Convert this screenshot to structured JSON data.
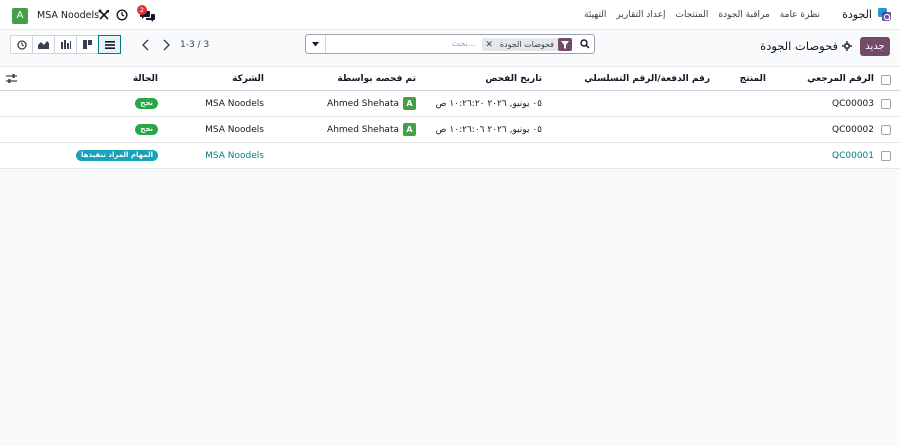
{
  "navbar": {
    "app_title": "الجودة",
    "menu": [
      "نظرة عامة",
      "مراقبة الجودة",
      "المنتجات",
      "إعداد التقارير",
      "التهيئة"
    ],
    "company_avatar_letter": "A",
    "company_name": "MSA Noodels",
    "chat_badge": "2"
  },
  "control": {
    "new_button": "جديد",
    "breadcrumb": "فحوصات الجودة",
    "search": {
      "facet_label": "فحوصات الجودة",
      "facet_remove": "✕",
      "placeholder": "بحث..."
    },
    "pager": "1-3 / 3"
  },
  "table": {
    "columns": {
      "reference": "الرقم المرجعي",
      "product": "المنتج",
      "lot": "رقم الدفعة/الرقم التسلسلي",
      "date": "تاريخ الفحص",
      "checked_by": "تم فحصه بواسطة",
      "company": "الشركة",
      "state": "الحالة"
    },
    "rows": [
      {
        "reference": "QC00003",
        "date": "٠٥ يونيو, ٢٠٢٦ ١٠:٢٦:٢٠ ص",
        "checked_by_avatar": "A",
        "checked_by": "Ahmed Shehata",
        "company": "MSA Noodels",
        "state": "نجح"
      },
      {
        "reference": "QC00002",
        "date": "٠٥ يونيو, ٢٠٢٦ ١٠:٢٦:٠٦ ص",
        "checked_by_avatar": "A",
        "checked_by": "Ahmed Shehata",
        "company": "MSA Noodels",
        "state": "نجح"
      },
      {
        "reference": "QC00001",
        "date": "",
        "checked_by_avatar": "",
        "checked_by": "",
        "company": "MSA Noodels",
        "state": "المهام المراد تنفيذها"
      }
    ]
  },
  "colors": {
    "brand": "#714b67",
    "link": "#017e84",
    "pass": "#28a745",
    "todo": "#17a2b8",
    "avatar": "#43a047",
    "chat_badge": "#d9363e"
  },
  "icons": {
    "app": "quality-app-icon",
    "tools": "tools-icon",
    "clock": "clock-icon",
    "chat": "chat-icon",
    "gear": "gear-icon",
    "search": "search-icon",
    "filter": "filter-icon",
    "toggle": "caret-down-icon",
    "views": [
      "list-icon",
      "kanban-icon",
      "pivot-icon",
      "graph-icon",
      "activity-icon"
    ],
    "optional_columns": "sliders-icon"
  }
}
